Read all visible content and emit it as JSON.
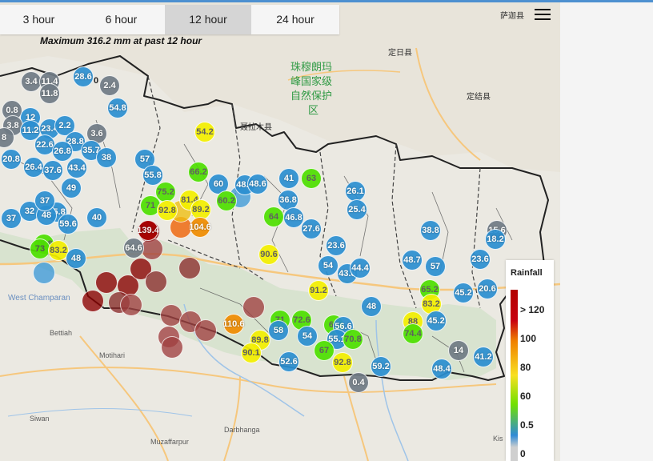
{
  "tabs": [
    {
      "label": "3 hour",
      "active": false
    },
    {
      "label": "6 hour",
      "active": false
    },
    {
      "label": "12 hour",
      "active": true
    },
    {
      "label": "24 hour",
      "active": false
    }
  ],
  "max_note": "Maximum 316.2 mm at past 12 hour",
  "legend": {
    "title": "Rainfall",
    "labels": [
      "> 120",
      "100",
      "80",
      "60",
      "0.5",
      "0"
    ]
  },
  "map_labels": {
    "everest": [
      "珠穆朗玛",
      "峰国家级",
      "自然保护",
      "区"
    ],
    "saga": "萨迦县",
    "dingri": "定日县",
    "dingjie": "定结县",
    "nyalam": "聂拉木县",
    "west_champaran": "West Champaran",
    "bettiah": "Bettiah",
    "motihari": "Motihari",
    "siwan": "Siwan",
    "muzaffarpur": "Muzaffarpur",
    "darbhanga": "Darbhanga",
    "kishan": "Kis"
  },
  "stations": [
    {
      "v": "3.4",
      "c": "gray"
    },
    {
      "v": "11.4",
      "c": "gray"
    },
    {
      "v": "28.6",
      "c": "blue"
    },
    {
      "v": "0",
      "c": "none"
    },
    {
      "v": "2.4",
      "c": "gray"
    },
    {
      "v": "11.8",
      "c": "gray"
    },
    {
      "v": "54.8",
      "c": "blue"
    },
    {
      "v": "0.8",
      "c": "gray"
    },
    {
      "v": "12",
      "c": "blue"
    },
    {
      "v": "3.8",
      "c": "gray"
    },
    {
      "v": "11.2",
      "c": "blue"
    },
    {
      "v": "23.4",
      "c": "blue"
    },
    {
      "v": "2.2",
      "c": "blue"
    },
    {
      "v": "3.6",
      "c": "gray"
    },
    {
      "v": "8",
      "c": "gray"
    },
    {
      "v": "22.6",
      "c": "blue"
    },
    {
      "v": "28.8",
      "c": "blue"
    },
    {
      "v": "20.8",
      "c": "blue"
    },
    {
      "v": "26.8",
      "c": "blue"
    },
    {
      "v": "35.7",
      "c": "blue"
    },
    {
      "v": "38",
      "c": "blue"
    },
    {
      "v": "26.4",
      "c": "blue"
    },
    {
      "v": "37.6",
      "c": "blue"
    },
    {
      "v": "43.4",
      "c": "blue"
    },
    {
      "v": "57",
      "c": "blue"
    },
    {
      "v": "49",
      "c": "blue"
    },
    {
      "v": "37",
      "c": "blue"
    },
    {
      "v": "45.8",
      "c": "blue"
    },
    {
      "v": "32",
      "c": "blue"
    },
    {
      "v": "48",
      "c": "blue"
    },
    {
      "v": "59.6",
      "c": "blue"
    },
    {
      "v": "40",
      "c": "blue"
    },
    {
      "v": "37",
      "c": "blue"
    },
    {
      "v": "79.8",
      "c": "green"
    },
    {
      "v": "73",
      "c": "green"
    },
    {
      "v": "83.2",
      "c": "yellow"
    },
    {
      "v": "48",
      "c": "blue"
    },
    {
      "v": "54.2",
      "c": "yellow"
    },
    {
      "v": "55.8",
      "c": "blue"
    },
    {
      "v": "66.2",
      "c": "green"
    },
    {
      "v": "75.2",
      "c": "green"
    },
    {
      "v": "71",
      "c": "green"
    },
    {
      "v": "92.8",
      "c": "yellow"
    },
    {
      "v": "81.4",
      "c": "yellow"
    },
    {
      "v": "89.2",
      "c": "yellow"
    },
    {
      "v": "60",
      "c": "blue"
    },
    {
      "v": "60.2",
      "c": "green"
    },
    {
      "v": "48.6",
      "c": "blue"
    },
    {
      "v": "48.6",
      "c": "blue"
    },
    {
      "v": "41",
      "c": "blue"
    },
    {
      "v": "63",
      "c": "green"
    },
    {
      "v": "26.1",
      "c": "blue"
    },
    {
      "v": "36.8",
      "c": "blue"
    },
    {
      "v": "25.4",
      "c": "blue"
    },
    {
      "v": "64",
      "c": "green"
    },
    {
      "v": "46.8",
      "c": "blue"
    },
    {
      "v": "27.6",
      "c": "blue"
    },
    {
      "v": "104.6",
      "c": "orange"
    },
    {
      "v": "139.4",
      "c": "red"
    },
    {
      "v": "64.6",
      "c": "gray"
    },
    {
      "v": "90.6",
      "c": "yellow"
    },
    {
      "v": "23.6",
      "c": "blue"
    },
    {
      "v": "38.8",
      "c": "blue"
    },
    {
      "v": "15.6",
      "c": "gray"
    },
    {
      "v": "18.2",
      "c": "blue"
    },
    {
      "v": "54",
      "c": "blue"
    },
    {
      "v": "43.8",
      "c": "blue"
    },
    {
      "v": "44.4",
      "c": "blue"
    },
    {
      "v": "48.7",
      "c": "blue"
    },
    {
      "v": "57",
      "c": "blue"
    },
    {
      "v": "23.6",
      "c": "blue"
    },
    {
      "v": "91.2",
      "c": "yellow"
    },
    {
      "v": "65.2",
      "c": "green"
    },
    {
      "v": "45.2",
      "c": "blue"
    },
    {
      "v": "20.6",
      "c": "blue"
    },
    {
      "v": "48",
      "c": "blue"
    },
    {
      "v": "83.2",
      "c": "yellow"
    },
    {
      "v": "110.6",
      "c": "orange"
    },
    {
      "v": "72.6",
      "c": "green"
    },
    {
      "v": "71",
      "c": "green"
    },
    {
      "v": "58",
      "c": "blue"
    },
    {
      "v": "54",
      "c": "blue"
    },
    {
      "v": "64",
      "c": "green"
    },
    {
      "v": "56.6",
      "c": "blue"
    },
    {
      "v": "55.1",
      "c": "blue"
    },
    {
      "v": "70.8",
      "c": "green"
    },
    {
      "v": "88",
      "c": "yellow"
    },
    {
      "v": "74.4",
      "c": "green"
    },
    {
      "v": "45.2",
      "c": "blue"
    },
    {
      "v": "89.8",
      "c": "yellow"
    },
    {
      "v": "90.1",
      "c": "yellow"
    },
    {
      "v": "67",
      "c": "green"
    },
    {
      "v": "92.8",
      "c": "yellow"
    },
    {
      "v": "52.6",
      "c": "blue"
    },
    {
      "v": "59.2",
      "c": "blue"
    },
    {
      "v": "14",
      "c": "gray"
    },
    {
      "v": "48.4",
      "c": "blue"
    },
    {
      "v": "41.2",
      "c": "blue"
    },
    {
      "v": "0.4",
      "c": "gray"
    }
  ]
}
